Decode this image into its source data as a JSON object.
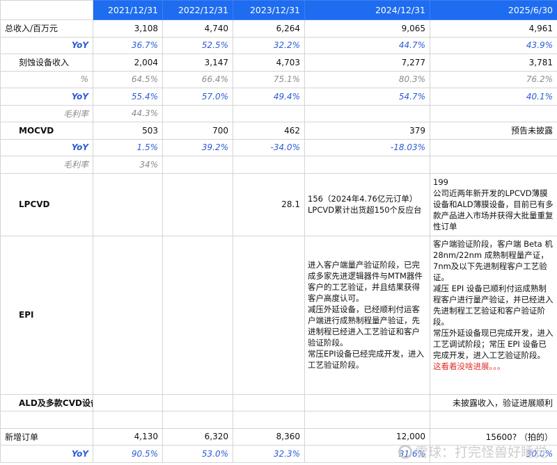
{
  "header": {
    "periods": [
      "2021/12/31",
      "2022/12/31",
      "2023/12/31",
      "2024/12/31",
      "2025/6/30"
    ]
  },
  "rows": {
    "total_revenue": {
      "label": "总收入/百万元",
      "values": [
        "3,108",
        "4,740",
        "6,264",
        "9,065",
        "4,961"
      ]
    },
    "total_yoy": {
      "label": "YoY",
      "values": [
        "36.7%",
        "52.5%",
        "32.2%",
        "44.7%",
        "43.9%"
      ]
    },
    "etch_revenue": {
      "label": "刻蚀设备收入",
      "values": [
        "2,004",
        "3,147",
        "4,703",
        "7,277",
        "3,781"
      ]
    },
    "etch_pct": {
      "label": "%",
      "values": [
        "64.5%",
        "66.4%",
        "75.1%",
        "80.3%",
        "76.2%"
      ]
    },
    "etch_yoy": {
      "label": "YoY",
      "values": [
        "55.4%",
        "57.0%",
        "49.4%",
        "54.7%",
        "40.1%"
      ]
    },
    "etch_margin": {
      "label": "毛利率",
      "values": [
        "44.3%"
      ]
    },
    "mocvd": {
      "label": "MOCVD",
      "values": [
        "503",
        "700",
        "462",
        "379",
        "预告未披露"
      ]
    },
    "mocvd_yoy": {
      "label": "YoY",
      "values": [
        "1.5%",
        "39.2%",
        "-34.0%",
        "-18.03%"
      ]
    },
    "mocvd_margin": {
      "label": "毛利率",
      "values": [
        "34%"
      ]
    },
    "lpcvd": {
      "label": "LPCVD",
      "v2023": "28.1",
      "v2024_line1": "156（2024年4.76亿元订单）",
      "v2024_line2": "LPCVD累计出货超150个反应台",
      "v2025_line1": "199",
      "v2025_line2": "公司近两年新开发的LPCVD薄膜设备和ALD薄膜设备，目前已有多款产品进入市场并获得大批量重复性订单"
    },
    "epi": {
      "label": "EPI",
      "v2024": [
        "进入客户端量产验证阶段，已完成多家先进逻辑器件与MTM器件客户的工艺验证，并且结果获得客户高度认可。",
        "减压外延设备，已经顺利付运客户端进行成熟制程量产验证，先进制程已经进入工艺验证和客户验证阶段。",
        "常压EPI设备已经完成开发，进入工艺验证阶段。"
      ],
      "v2025": [
        "客户端验证阶段，客户端 Beta 机28nm/22nm 成熟制程量产证， 7nm及以下先进制程客户工艺验证。",
        "减压 EPI 设备已顺利付运成熟制程客户进行量产验证，并已经进入先进制程工艺验证和客户验证阶段。",
        "常压外延设备现已完成开发，进入工艺调试阶段；常压 EPI 设备已完成开发，进入工艺验证阶段。"
      ],
      "v2025_note": "这看着没啥进展。。。"
    },
    "ald_cvd": {
      "label": "ALD及多款CVD设备",
      "v2025": "未披露收入，验证进展顺利"
    },
    "new_orders": {
      "label": "新增订单",
      "values": [
        "4,130",
        "6,320",
        "8,360",
        "12,000",
        "15600? （拍的）"
      ]
    },
    "orders_yoy": {
      "label": "YoY",
      "values": [
        "90.5%",
        "53.0%",
        "32.3%",
        "31.6%",
        "30.0%"
      ]
    }
  },
  "watermark": {
    "text": "雪球：打完怪兽好睡觉",
    "icon": "snowball-logo-icon"
  },
  "colors": {
    "header_bg": "#1e6cf0",
    "yoy_text": "#2a5bd7",
    "note_red": "#e0302a"
  }
}
